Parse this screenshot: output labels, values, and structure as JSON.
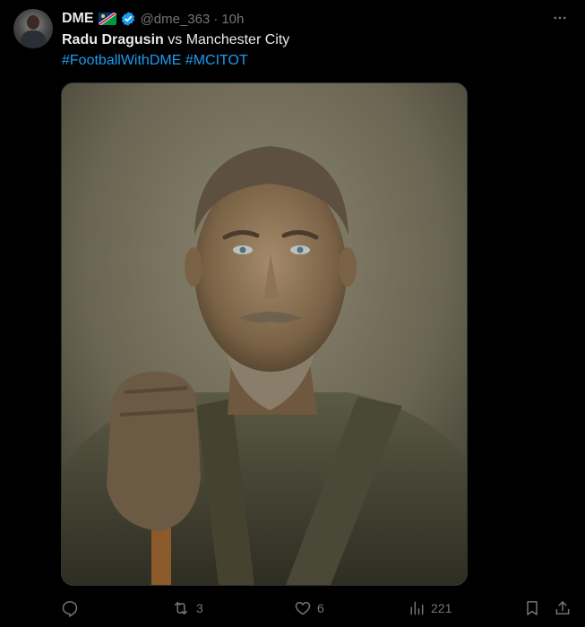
{
  "author": {
    "display_name": "DME",
    "flag_icon": "namibia-flag-icon",
    "verified_icon": "verified-badge-icon",
    "handle": "@dme_363",
    "separator": "·",
    "time": "10h"
  },
  "tweet": {
    "player": "Radu Dragusin",
    "rest": " vs Manchester City",
    "hashtags": [
      "#FootballWithDME",
      "#MCITOT"
    ]
  },
  "actions": {
    "reply": {
      "icon": "reply-icon",
      "count": ""
    },
    "retweet": {
      "icon": "retweet-icon",
      "count": "3"
    },
    "like": {
      "icon": "heart-icon",
      "count": "6"
    },
    "views": {
      "icon": "views-chart-icon",
      "count": "221"
    },
    "bookmark": {
      "icon": "bookmark-icon"
    },
    "share": {
      "icon": "share-icon"
    }
  },
  "colors": {
    "background": "#000000",
    "text": "#e7e9ea",
    "secondary": "#71767b",
    "accent": "#1d9bf0"
  }
}
